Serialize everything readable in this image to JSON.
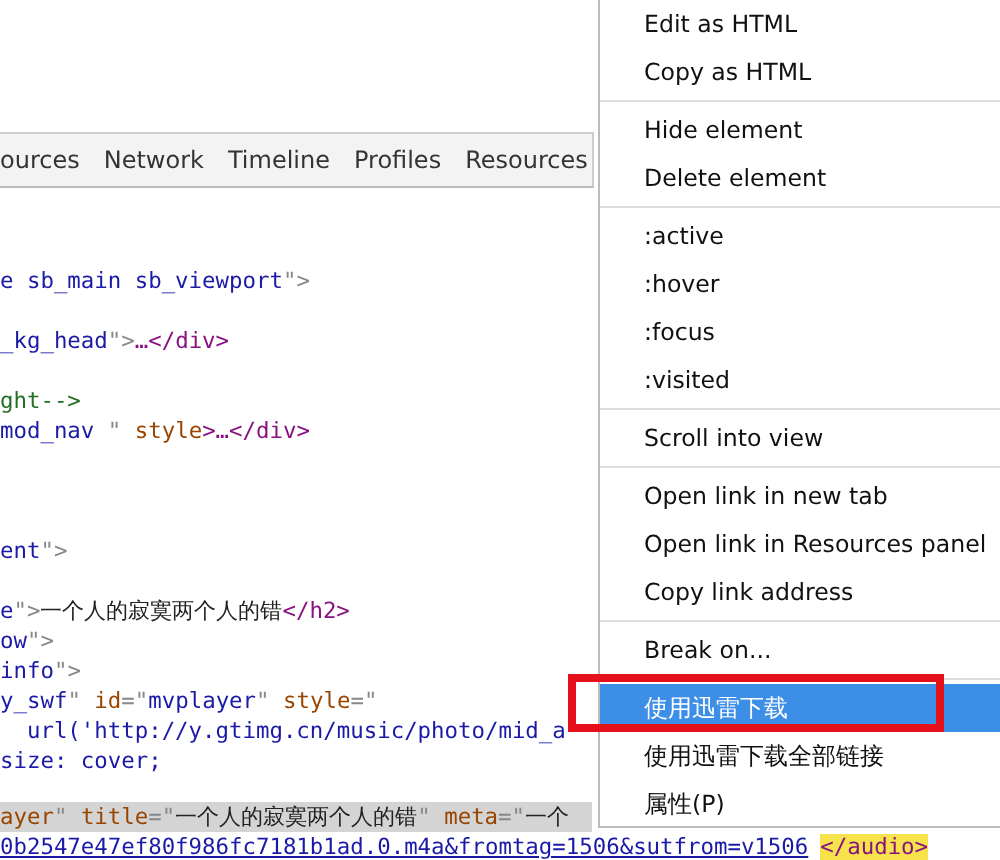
{
  "tabs": [
    {
      "label": "ources",
      "selected": false
    },
    {
      "label": "Network",
      "selected": false
    },
    {
      "label": "Timeline",
      "selected": false
    },
    {
      "label": "Profiles",
      "selected": false
    },
    {
      "label": "Resources",
      "selected": false
    }
  ],
  "code": {
    "blocks": [
      {
        "lines": [
          {
            "selected": false,
            "segments": [
              {
                "kind": "val",
                "text": "e sb_main sb_viewport"
              },
              {
                "kind": "punct",
                "text": "\">"
              }
            ]
          }
        ]
      },
      {
        "lines": [
          {
            "selected": false,
            "segments": [
              {
                "kind": "val",
                "text": "_kg_head"
              },
              {
                "kind": "punct",
                "text": "\">"
              },
              {
                "kind": "tag",
                "text": "…</div>"
              }
            ]
          }
        ]
      },
      {
        "lines": [
          {
            "selected": false,
            "segments": [
              {
                "kind": "comment",
                "text": "ght-->"
              }
            ]
          },
          {
            "selected": false,
            "segments": [
              {
                "kind": "val",
                "text": "mod_nav "
              },
              {
                "kind": "punct",
                "text": "\" "
              },
              {
                "kind": "attr",
                "text": "style"
              },
              {
                "kind": "tag",
                "text": ">…</div>"
              }
            ]
          }
        ]
      },
      {
        "lines": [
          {
            "selected": false,
            "segments": [
              {
                "kind": "val",
                "text": "ent"
              },
              {
                "kind": "punct",
                "text": "\">"
              }
            ]
          }
        ]
      },
      {
        "lines": [
          {
            "selected": false,
            "segments": [
              {
                "kind": "val",
                "text": "e"
              },
              {
                "kind": "punct",
                "text": "\">"
              },
              {
                "kind": "text",
                "text": "一个人的寂寞两个人的错"
              },
              {
                "kind": "tag",
                "text": "</h2>"
              }
            ]
          },
          {
            "selected": false,
            "segments": [
              {
                "kind": "val",
                "text": "ow"
              },
              {
                "kind": "punct",
                "text": "\">"
              }
            ]
          },
          {
            "selected": false,
            "segments": [
              {
                "kind": "val",
                "text": "info"
              },
              {
                "kind": "punct",
                "text": "\">"
              }
            ]
          },
          {
            "selected": false,
            "segments": [
              {
                "kind": "val",
                "text": "y_swf"
              },
              {
                "kind": "punct",
                "text": "\" "
              },
              {
                "kind": "attr",
                "text": "id"
              },
              {
                "kind": "punct",
                "text": "=\""
              },
              {
                "kind": "val",
                "text": "mvplayer"
              },
              {
                "kind": "punct",
                "text": "\" "
              },
              {
                "kind": "attr",
                "text": "style"
              },
              {
                "kind": "punct",
                "text": "=\""
              }
            ]
          },
          {
            "selected": false,
            "segments": [
              {
                "kind": "val",
                "text": "  url('http://y.gtimg.cn/music/photo/mid_a"
              }
            ]
          },
          {
            "selected": false,
            "segments": [
              {
                "kind": "val",
                "text": "size: cover;"
              }
            ]
          }
        ]
      },
      {
        "lines": [
          {
            "selected": true,
            "segments": [
              {
                "kind": "attr",
                "text": "ayer"
              },
              {
                "kind": "punct",
                "text": "\" "
              },
              {
                "kind": "attr",
                "text": "title"
              },
              {
                "kind": "punct",
                "text": "=\""
              },
              {
                "kind": "text",
                "text": "一个人的寂寞两个人的错"
              },
              {
                "kind": "punct",
                "text": "\" "
              },
              {
                "kind": "attr",
                "text": "meta"
              },
              {
                "kind": "punct",
                "text": "=\""
              },
              {
                "kind": "text",
                "text": "一个"
              }
            ]
          },
          {
            "selected": false,
            "segments": [
              {
                "kind": "link",
                "text": "0b2547e47ef80f986fc7181b1ad.0.m4a&fromtag=1506&sutfrom=v1506"
              },
              {
                "kind": "mark",
                "text": "</audio>"
              }
            ]
          }
        ]
      }
    ]
  },
  "context_menu": {
    "groups": [
      [
        {
          "label": "Edit as HTML",
          "selected": false
        },
        {
          "label": "Copy as HTML",
          "selected": false
        }
      ],
      [
        {
          "label": "Hide element",
          "selected": false
        },
        {
          "label": "Delete element",
          "selected": false
        }
      ],
      [
        {
          "label": ":active",
          "selected": false
        },
        {
          "label": ":hover",
          "selected": false
        },
        {
          "label": ":focus",
          "selected": false
        },
        {
          "label": ":visited",
          "selected": false
        }
      ],
      [
        {
          "label": "Scroll into view",
          "selected": false
        }
      ],
      [
        {
          "label": "Open link in new tab",
          "selected": false
        },
        {
          "label": "Open link in Resources panel",
          "selected": false
        },
        {
          "label": "Copy link address",
          "selected": false
        }
      ],
      [
        {
          "label": "Break on...",
          "selected": false
        }
      ],
      [
        {
          "label": "使用迅雷下载",
          "selected": true
        },
        {
          "label": "使用迅雷下载全部链接",
          "selected": false
        },
        {
          "label": "属性(P)",
          "selected": false
        }
      ]
    ]
  }
}
